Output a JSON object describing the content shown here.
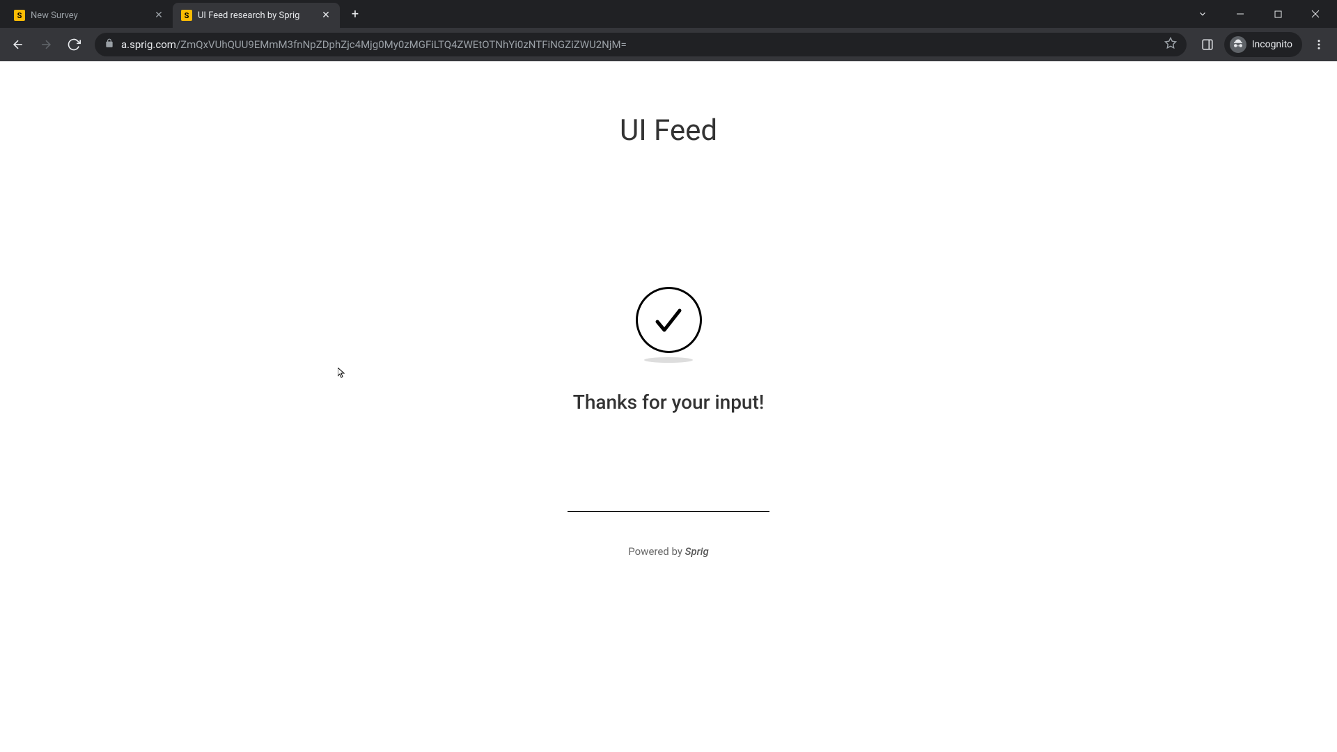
{
  "browser": {
    "tabs": [
      {
        "title": "New Survey",
        "favicon_letter": "S",
        "active": false
      },
      {
        "title": "UI Feed research by Sprig",
        "favicon_letter": "S",
        "active": true
      }
    ],
    "url_domain": "a.sprig.com",
    "url_path": "/ZmQxVUhQUU9EMmM3fnNpZDphZjc4Mjg0My0zMGFiLTQ4ZWEtOTNhYi0zNTFiNGZiZWU2NjM=",
    "incognito_label": "Incognito"
  },
  "page": {
    "title": "UI Feed",
    "message": "Thanks for your input!",
    "footer_prefix": "Powered by ",
    "footer_brand": "Sprig"
  }
}
